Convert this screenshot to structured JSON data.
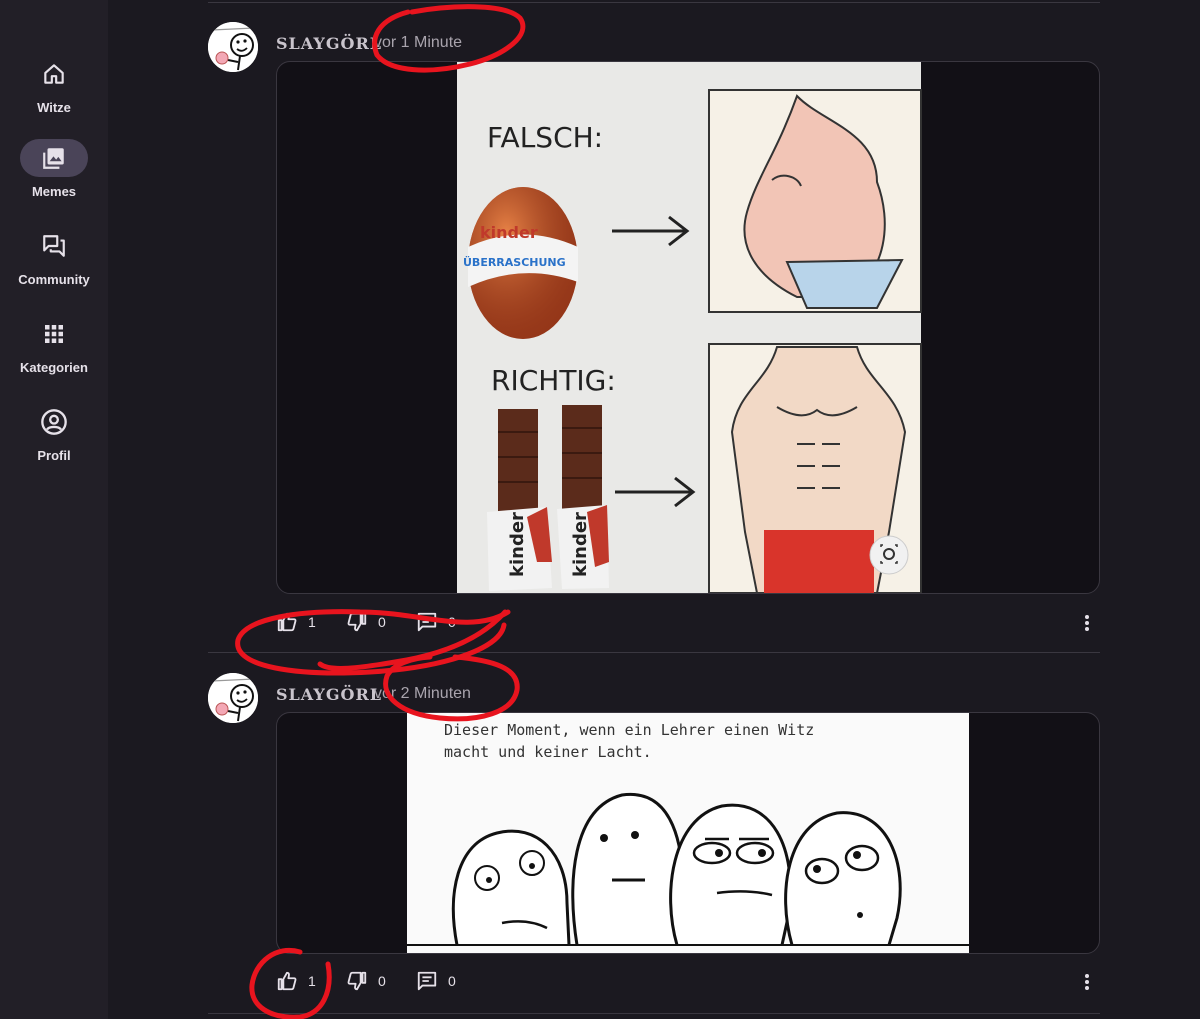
{
  "nav": {
    "items": [
      {
        "label": "Witze",
        "icon": "home-icon"
      },
      {
        "label": "Memes",
        "icon": "image-gallery-icon",
        "active": true
      },
      {
        "label": "Community",
        "icon": "forum-icon"
      },
      {
        "label": "Kategorien",
        "icon": "apps-grid-icon"
      },
      {
        "label": "Profil",
        "icon": "account-circle-icon"
      }
    ]
  },
  "posts": [
    {
      "author": "SLAYGÖRL",
      "time": "vor 1 Minute",
      "meme": {
        "panel_top_label": "FALSCH:",
        "panel_bottom_label": "RICHTIG:",
        "egg_brand": "kinder",
        "egg_sub": "ÜBERRASCHUNG",
        "bar_brand": "kinder"
      },
      "likes": "1",
      "dislikes": "0",
      "comments": "0"
    },
    {
      "author": "SLAYGÖRL",
      "time": "vor 2 Minuten",
      "meme": {
        "caption_line1": "Dieser Moment, wenn ein Lehrer einen Witz",
        "caption_line2": "macht und keiner Lacht."
      },
      "likes": "1",
      "dislikes": "0",
      "comments": "0"
    }
  ],
  "colors": {
    "annotation": "#e8141e",
    "active_nav": "#4a4458",
    "background": "#1b1920"
  }
}
